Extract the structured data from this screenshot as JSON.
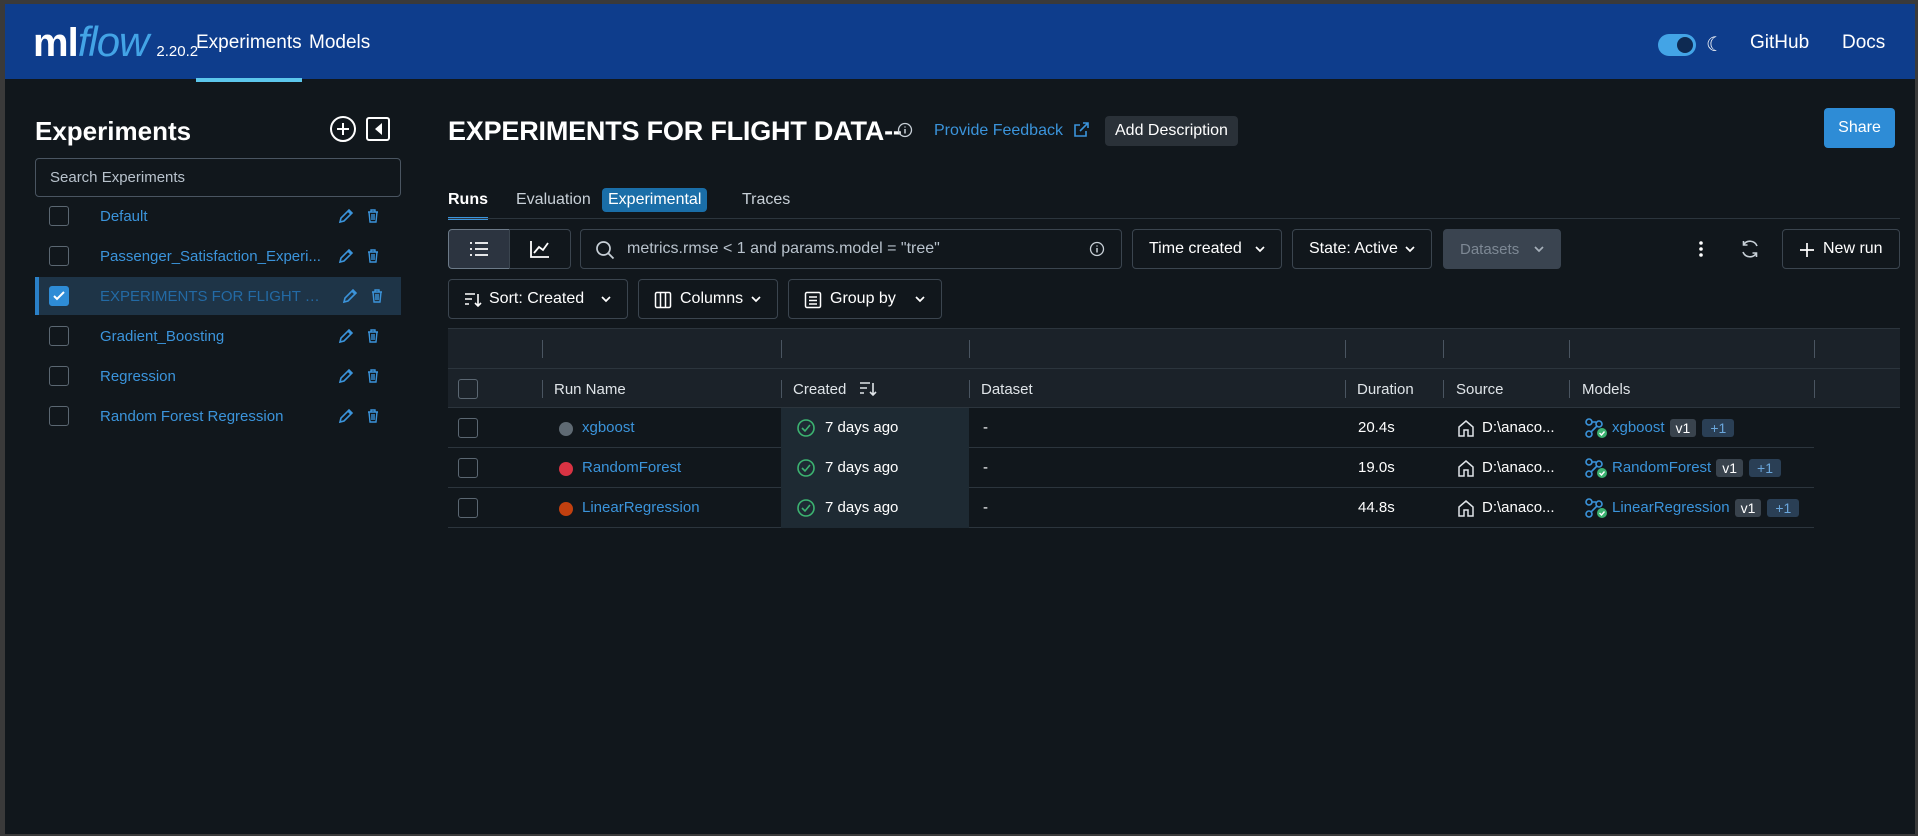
{
  "app": {
    "logo_ml": "ml",
    "logo_flow": "flow",
    "version": "2.20.2",
    "nav": {
      "experiments": "Experiments",
      "models": "Models",
      "github": "GitHub",
      "docs": "Docs"
    },
    "theme_toggle": "dark"
  },
  "sidebar": {
    "title": "Experiments",
    "search_placeholder": "Search Experiments",
    "items": [
      {
        "label": "Default",
        "checked": false
      },
      {
        "label": "Passenger_Satisfaction_Experi...",
        "checked": false
      },
      {
        "label": "EXPERIMENTS FOR FLIGHT D...",
        "checked": true
      },
      {
        "label": "Gradient_Boosting",
        "checked": false
      },
      {
        "label": "Regression",
        "checked": false
      },
      {
        "label": "Random Forest Regression",
        "checked": false
      }
    ]
  },
  "main": {
    "title": "EXPERIMENTS FOR FLIGHT DATA--",
    "feedback_label": "Provide Feedback",
    "add_description_label": "Add Description",
    "share_label": "Share",
    "tabs": {
      "runs": "Runs",
      "evaluation": "Evaluation",
      "experimental_badge": "Experimental",
      "traces": "Traces"
    },
    "toolbar": {
      "search_placeholder": "metrics.rmse < 1 and params.model = \"tree\"",
      "time_created": "Time created",
      "state": "State: Active",
      "datasets": "Datasets",
      "new_run": "New run",
      "sort": "Sort: Created",
      "columns": "Columns",
      "group_by": "Group by"
    },
    "table": {
      "headers": {
        "run_name": "Run Name",
        "created": "Created",
        "dataset": "Dataset",
        "duration": "Duration",
        "source": "Source",
        "models": "Models"
      },
      "rows": [
        {
          "run_name": "xgboost",
          "dot_color": "#5f6a73",
          "created": "7 days ago",
          "dataset": "-",
          "duration": "20.4s",
          "source": "D:\\anaco...",
          "model": "xgboost",
          "version": "v1",
          "plus": "+1"
        },
        {
          "run_name": "RandomForest",
          "dot_color": "#d93343",
          "created": "7 days ago",
          "dataset": "-",
          "duration": "19.0s",
          "source": "D:\\anaco...",
          "model": "RandomForest",
          "version": "v1",
          "plus": "+1"
        },
        {
          "run_name": "LinearRegression",
          "dot_color": "#c2400f",
          "created": "7 days ago",
          "dataset": "-",
          "duration": "44.8s",
          "source": "D:\\anaco...",
          "model": "LinearRegression",
          "version": "v1",
          "plus": "+1"
        }
      ]
    }
  },
  "colors": {
    "header": "#0e3d8c",
    "accent": "#2e8cd6",
    "link": "#3b94db",
    "background": "#11171c"
  }
}
